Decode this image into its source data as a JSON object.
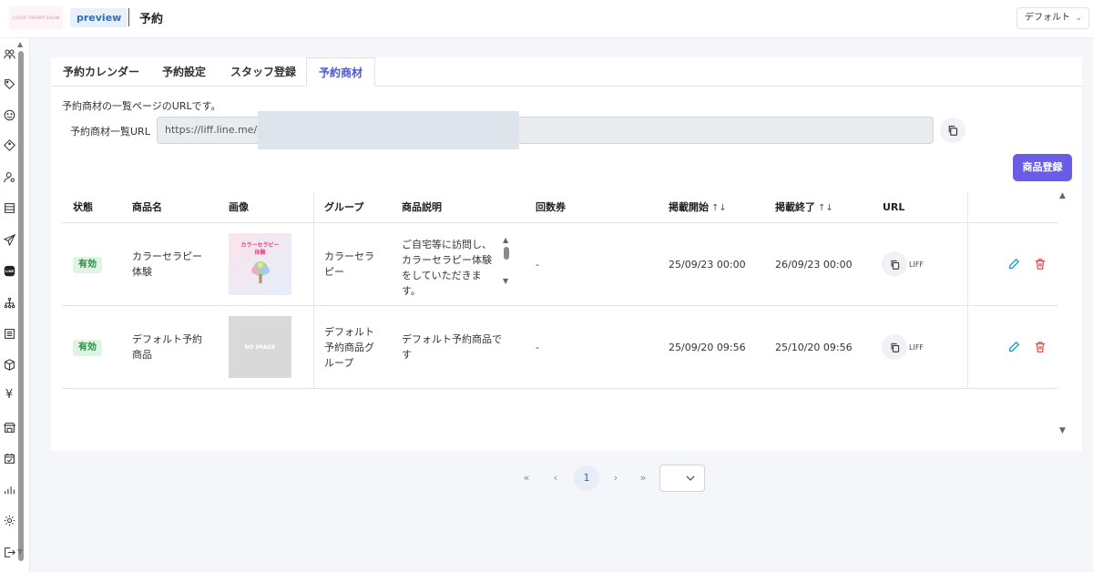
{
  "header": {
    "logo_text": "COLOR THERAPY SALON",
    "preview_badge": "preview",
    "page_title": "予約",
    "top_select": "デフォルト"
  },
  "sidebar": {
    "icons": [
      "people-icon",
      "tag-icon",
      "smile-icon",
      "coupon-icon",
      "user-setting-icon",
      "list-icon",
      "send-icon",
      "line-icon",
      "flow-icon",
      "document-icon",
      "box-icon",
      "yen-icon",
      "store-icon",
      "calendar-check-icon",
      "chart-icon",
      "gear-icon",
      "logout-icon"
    ],
    "line_label": "LINE",
    "yen_symbol": "¥"
  },
  "tabs": [
    {
      "label": "予約カレンダー",
      "active": false
    },
    {
      "label": "予約設定",
      "active": false
    },
    {
      "label": "スタッフ登録",
      "active": false
    },
    {
      "label": "予約商材",
      "active": true
    }
  ],
  "url_section": {
    "description": "予約商材の一覧ページのURLです。",
    "label": "予約商材一覧URL",
    "value": "https://liff.line.me/"
  },
  "register_button": "商品登録",
  "table": {
    "headers": {
      "status": "状態",
      "name": "商品名",
      "image": "画像",
      "group": "グループ",
      "description": "商品説明",
      "tickets": "回数券",
      "start": "掲載開始",
      "end": "掲載終了",
      "url": "URL"
    },
    "sort_icon": "↑↓",
    "rows": [
      {
        "status": "有効",
        "name_line1": "カラーセラピー",
        "name_line2": "体験",
        "image_text_line1": "カラーセラピー",
        "image_text_line2": "体験",
        "group_line1": "カラーセラ",
        "group_line2": "ピー",
        "desc_line1": "ご自宅等に訪問し、",
        "desc_line2": "カラーセラピー体験",
        "desc_line3": "をしていただきま",
        "desc_line4": "す。",
        "tickets": "-",
        "start": "25/09/23 00:00",
        "end": "26/09/23 00:00",
        "liff": "LIFF"
      },
      {
        "status": "有効",
        "name_line1": "デフォルト予約",
        "name_line2": "商品",
        "image_text": "NO IMAGE",
        "group_line1": "デフォルト",
        "group_line2": "予約商品グ",
        "group_line3": "ループ",
        "desc_line1": "デフォルト予約商品で",
        "desc_line2": "す",
        "tickets": "-",
        "start": "25/09/20 09:56",
        "end": "25/10/20 09:56",
        "liff": "LIFF"
      }
    ]
  },
  "pagination": {
    "first": "«",
    "prev": "‹",
    "current": "1",
    "next": "›",
    "last": "»"
  },
  "colors": {
    "accent": "#6b5ce7",
    "active_tab": "#4a5ad6",
    "badge_bg": "#dff4e4",
    "badge_text": "#2f8a45",
    "edit": "#1a9fc4",
    "delete": "#e05252"
  }
}
